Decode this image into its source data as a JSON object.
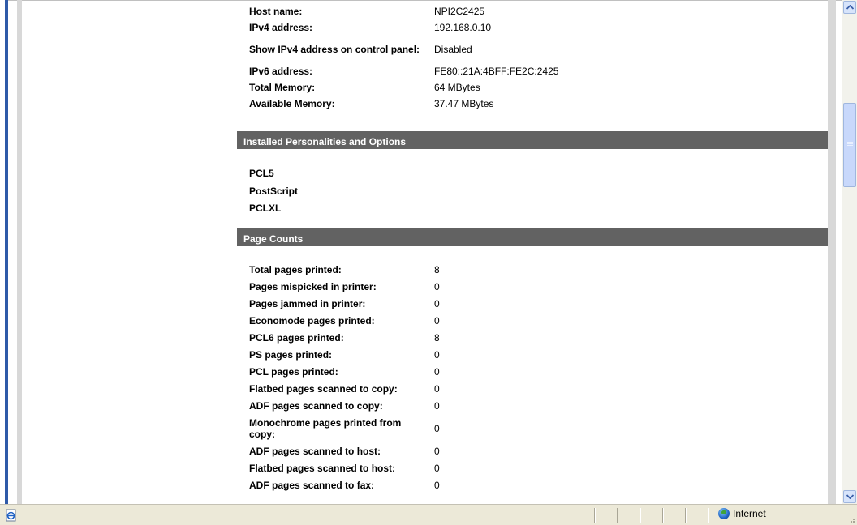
{
  "system_info": [
    {
      "label": "Host name:",
      "value": "NPI2C2425"
    },
    {
      "label": "IPv4 address:",
      "value": "192.168.0.10"
    },
    {
      "label": "Show IPv4 address on control panel:",
      "value": "Disabled"
    },
    {
      "label": "IPv6 address:",
      "value": "FE80::21A:4BFF:FE2C:2425"
    },
    {
      "label": "Total Memory:",
      "value": "64 MBytes"
    },
    {
      "label": "Available Memory:",
      "value": "37.47 MBytes"
    }
  ],
  "personalities": {
    "heading": "Installed Personalities and Options",
    "items": [
      "PCL5",
      "PostScript",
      "PCLXL"
    ]
  },
  "page_counts": {
    "heading": "Page Counts",
    "rows": [
      {
        "label": "Total pages printed:",
        "value": "8"
      },
      {
        "label": "Pages mispicked in printer:",
        "value": "0"
      },
      {
        "label": "Pages jammed in printer:",
        "value": "0"
      },
      {
        "label": "Economode pages printed:",
        "value": "0"
      },
      {
        "label": "PCL6 pages printed:",
        "value": "8"
      },
      {
        "label": "PS pages printed:",
        "value": "0"
      },
      {
        "label": "PCL pages printed:",
        "value": "0"
      },
      {
        "label": "Flatbed pages scanned to copy:",
        "value": "0"
      },
      {
        "label": "ADF pages scanned to copy:",
        "value": "0"
      },
      {
        "label": "Monochrome pages printed from copy:",
        "value": "0"
      },
      {
        "label": "ADF pages scanned to host:",
        "value": "0"
      },
      {
        "label": "Flatbed pages scanned to host:",
        "value": "0"
      },
      {
        "label": "ADF pages scanned to fax:",
        "value": "0"
      }
    ]
  },
  "statusbar": {
    "zone_label": "Internet",
    "page_icon": "ie-page-icon",
    "zone_icon": "globe-icon"
  },
  "colors": {
    "section_header_bg": "#626262",
    "section_header_text": "#ffffff",
    "frame_blue": "#2f5aa8",
    "statusbar_bg": "#ece9d8"
  }
}
